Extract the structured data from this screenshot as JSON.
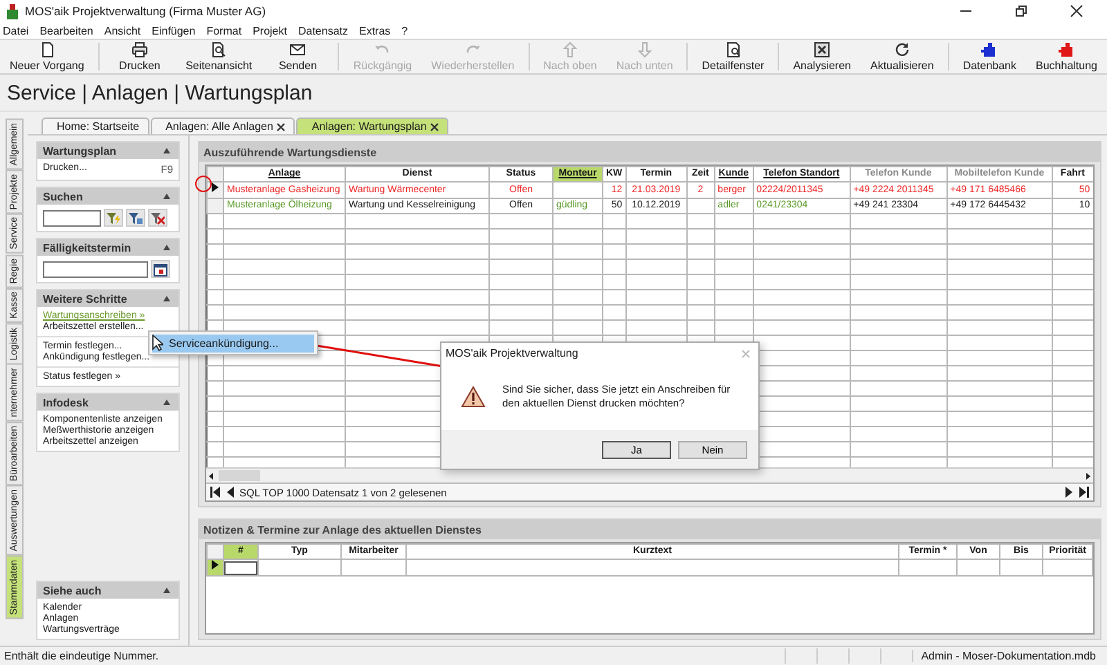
{
  "window": {
    "title": "MOS'aik Projektverwaltung (Firma Muster AG)"
  },
  "menu": [
    "Datei",
    "Bearbeiten",
    "Ansicht",
    "Einfügen",
    "Format",
    "Projekt",
    "Datensatz",
    "Extras",
    "?"
  ],
  "toolbar": {
    "groups": [
      [
        {
          "label": "Neuer Vorgang",
          "disabled": false
        }
      ],
      [
        {
          "label": "Drucken",
          "disabled": false
        },
        {
          "label": "Seitenansicht",
          "disabled": false
        },
        {
          "label": "Senden",
          "disabled": false
        }
      ],
      [
        {
          "label": "Rückgängig",
          "disabled": true
        },
        {
          "label": "Wiederherstellen",
          "disabled": true
        }
      ],
      [
        {
          "label": "Nach oben",
          "disabled": true
        },
        {
          "label": "Nach unten",
          "disabled": true
        }
      ],
      [
        {
          "label": "Detailfenster",
          "disabled": false
        }
      ],
      [
        {
          "label": "Analysieren",
          "disabled": false
        },
        {
          "label": "Aktualisieren",
          "disabled": false
        }
      ],
      [
        {
          "label": "Datenbank",
          "disabled": false
        },
        {
          "label": "Buchhaltung",
          "disabled": false
        }
      ]
    ]
  },
  "breadcrumb": "Service | Anlagen | Wartungsplan",
  "tabs": [
    {
      "label": "Home: Startseite",
      "closable": false,
      "selected": false
    },
    {
      "label": "Anlagen: Alle Anlagen",
      "closable": true,
      "selected": false
    },
    {
      "label": "Anlagen: Wartungsplan",
      "closable": true,
      "selected": true
    }
  ],
  "side_tabs": [
    {
      "label": "Allgemein",
      "selected": false
    },
    {
      "label": "Projekte",
      "selected": false
    },
    {
      "label": "Service",
      "selected": false
    },
    {
      "label": "Regie",
      "selected": false
    },
    {
      "label": "Kasse",
      "selected": false
    },
    {
      "label": "Logistik",
      "selected": false
    },
    {
      "label": "nternehmer",
      "selected": false
    },
    {
      "label": "Büroarbeiten",
      "selected": false
    },
    {
      "label": "Auswertungen",
      "selected": false
    },
    {
      "label": "Stammdaten",
      "selected": true
    }
  ],
  "sidebar": {
    "panels": [
      {
        "title": "Wartungsplan",
        "kind": "menu",
        "expanded": true,
        "groups": [
          [
            {
              "label": "Drucken...",
              "shortcut": "F9",
              "selected": false
            }
          ]
        ]
      },
      {
        "title": "Suchen",
        "kind": "search",
        "expanded": true
      },
      {
        "title": "Fälligkeitstermin",
        "kind": "date",
        "expanded": true
      },
      {
        "title": "Weitere Schritte",
        "kind": "menu",
        "expanded": true,
        "groups": [
          [
            {
              "label": "Wartungsanschreiben »",
              "selected": true
            },
            {
              "label": "Arbeitszettel erstellen...",
              "selected": false
            }
          ],
          [
            {
              "label": "Termin festlegen...",
              "selected": false
            },
            {
              "label": "Ankündigung festlegen...",
              "selected": false
            }
          ],
          [
            {
              "label": "Status festlegen »",
              "selected": false
            }
          ]
        ]
      },
      {
        "title": "Infodesk",
        "kind": "menu",
        "expanded": true,
        "groups": [
          [
            {
              "label": "Komponentenliste anzeigen",
              "selected": false
            },
            {
              "label": "Meßwerthistorie anzeigen",
              "selected": false
            },
            {
              "label": "Arbeitszettel anzeigen",
              "selected": false
            }
          ]
        ]
      }
    ],
    "footer_panels": [
      {
        "title": "Siehe auch",
        "kind": "menu",
        "expanded": true,
        "groups": [
          [
            {
              "label": "Kalender",
              "selected": false
            },
            {
              "label": "Anlagen",
              "selected": false
            },
            {
              "label": "Wartungsverträge",
              "selected": false
            }
          ]
        ]
      }
    ]
  },
  "grid": {
    "title": "Auszuführende Wartungsdienste",
    "columns": [
      {
        "label": "Anlage",
        "sortable": true,
        "selected": false,
        "dimmed": false
      },
      {
        "label": "Dienst",
        "sortable": false,
        "selected": false,
        "dimmed": false
      },
      {
        "label": "Status",
        "sortable": false,
        "selected": false,
        "dimmed": false
      },
      {
        "label": "Monteur",
        "sortable": true,
        "selected": true,
        "dimmed": false
      },
      {
        "label": "KW",
        "sortable": false,
        "selected": false,
        "dimmed": false
      },
      {
        "label": "Termin",
        "sortable": false,
        "selected": false,
        "dimmed": false
      },
      {
        "label": "Zeit",
        "sortable": false,
        "selected": false,
        "dimmed": false
      },
      {
        "label": "Kunde",
        "sortable": true,
        "selected": false,
        "dimmed": false
      },
      {
        "label": "Telefon Standort",
        "sortable": true,
        "selected": false,
        "dimmed": false
      },
      {
        "label": "Telefon Kunde",
        "sortable": false,
        "selected": false,
        "dimmed": true
      },
      {
        "label": "Mobiltelefon Kunde",
        "sortable": false,
        "selected": false,
        "dimmed": true
      },
      {
        "label": "Fahrt",
        "sortable": false,
        "selected": false,
        "dimmed": false
      }
    ],
    "rows": [
      {
        "selected": true,
        "cells": [
          {
            "text": "Musteranlage Gasheizung",
            "color": "#f02828"
          },
          {
            "text": "Wartung Wärmecenter",
            "color": "#f02828"
          },
          {
            "text": "Offen",
            "color": "#f02828"
          },
          null,
          {
            "text": "12",
            "color": "#f02828"
          },
          {
            "text": "21.03.2019",
            "color": "#f02828"
          },
          {
            "text": "2",
            "color": "#f02828"
          },
          {
            "text": "berger",
            "color": "#f02828"
          },
          {
            "text": "02224/2011345",
            "color": "#f02828"
          },
          {
            "text": "+49 2224 2011345",
            "color": "#f02828"
          },
          {
            "text": "+49 171 6485466",
            "color": "#f02828"
          },
          {
            "text": "50",
            "color": "#f02828"
          }
        ]
      },
      {
        "selected": false,
        "cells": [
          {
            "text": "Musteranlage Ölheizung",
            "color": "#5a9a28"
          },
          {
            "text": "Wartung und Kesselreinigung",
            "color": "#1a1a1a"
          },
          {
            "text": "Offen",
            "color": "#1a1a1a"
          },
          {
            "text": "güdling",
            "color": "#5a9a28"
          },
          {
            "text": "50",
            "color": "#1a1a1a"
          },
          {
            "text": "10.12.2019",
            "color": "#1a1a1a"
          },
          null,
          {
            "text": "adler",
            "color": "#5a9a28"
          },
          {
            "text": "0241/23304",
            "color": "#5a9a28"
          },
          {
            "text": "+49 241 23304",
            "color": "#1a1a1a"
          },
          {
            "text": "+49 172 6445432",
            "color": "#1a1a1a"
          },
          {
            "text": "10",
            "color": "#1a1a1a"
          }
        ]
      }
    ],
    "status": "SQL TOP 1000 Datensatz 1 von 2 gelesenen"
  },
  "notes": {
    "title": "Notizen & Termine zur Anlage des aktuellen Dienstes",
    "columns": [
      {
        "label": "#",
        "selected": true
      },
      {
        "label": "Typ",
        "selected": false
      },
      {
        "label": "Mitarbeiter",
        "selected": false
      },
      {
        "label": "Kurztext",
        "selected": false
      },
      {
        "label": "Termin *",
        "selected": false
      },
      {
        "label": "Von",
        "selected": false
      },
      {
        "label": "Bis",
        "selected": false
      },
      {
        "label": "Priorität",
        "selected": false
      }
    ]
  },
  "context_menu": {
    "items": [
      {
        "label": "Serviceankündigung...",
        "selected": true
      }
    ]
  },
  "dialog": {
    "title": "MOS'aik Projektverwaltung",
    "message": "Sind Sie sicher, dass Sie jetzt ein Anschreiben für den aktuellen Dienst drucken möchten?",
    "buttons": [
      {
        "label": "Ja",
        "default": true
      },
      {
        "label": "Nein",
        "default": false
      }
    ]
  },
  "status_bar": {
    "message": "Enthält die eindeutige Nummer.",
    "database": "Admin - Moser-Dokumentation.mdb"
  }
}
